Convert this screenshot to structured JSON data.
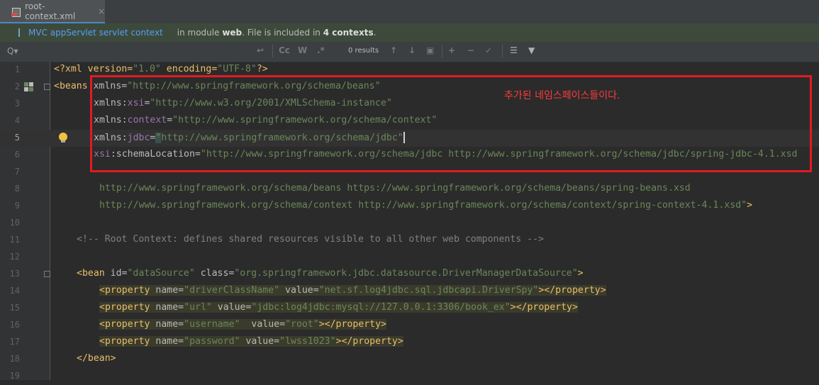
{
  "tab": {
    "filename": "root-context.xml",
    "close": "×"
  },
  "infobar": {
    "link": "MVC appServlet servlet context",
    "text_before": "in module",
    "module": "web",
    "text_middle": ". File is included in",
    "contexts": "4 contexts",
    "text_end": "."
  },
  "search": {
    "icon": "Q▾",
    "results": "0 results",
    "toolbar": {
      "cc": "Cc",
      "w": "W",
      "regex": ".*"
    }
  },
  "code": {
    "l1": {
      "num": "1",
      "t1": "<?xml version=",
      "v1": "\"1.0\"",
      "t2": " encoding=",
      "v2": "\"UTF-8\"",
      "t3": "?>"
    },
    "l2": {
      "num": "2",
      "tag": "<beans ",
      "a1": "xmlns",
      "eq": "=",
      "v": "\"http://www.springframework.org/schema/beans\""
    },
    "l3": {
      "num": "3",
      "a1": "xmlns:",
      "a2": "xsi",
      "eq": "=",
      "v": "\"http://www.w3.org/2001/XMLSchema-instance\""
    },
    "l4": {
      "num": "4",
      "a1": "xmlns:",
      "a2": "context",
      "eq": "=",
      "v": "\"http://www.springframework.org/schema/context\""
    },
    "l5": {
      "num": "5",
      "a1": "xmlns:",
      "a2": "jdbc",
      "eq": "=",
      "q": "\"",
      "v": "http://www.springframework.org/schema/jdbc\""
    },
    "l6": {
      "num": "6",
      "a1": "xsi",
      "a2": ":schemaLocation",
      "eq": "=",
      "v": "\"http://www.springframework.org/schema/jdbc http://www.springframework.org/schema/jdbc/spring-jdbc-4.1.xsd"
    },
    "l7": {
      "num": "7"
    },
    "l8": {
      "num": "8",
      "v": "http://www.springframework.org/schema/beans https://www.springframework.org/schema/beans/spring-beans.xsd"
    },
    "l9": {
      "num": "9",
      "v": "http://www.springframework.org/schema/context http://www.springframework.org/schema/context/spring-context-4.1.xsd\"",
      "end": ">"
    },
    "l10": {
      "num": "10"
    },
    "l11": {
      "num": "11",
      "c": "<!-- Root Context: defines shared resources visible to all other web components -->"
    },
    "l12": {
      "num": "12"
    },
    "l13": {
      "num": "13",
      "tag": "<bean ",
      "a1": "id",
      "eq1": "=",
      "v1": "\"dataSource\"",
      "a2": " class",
      "eq2": "=",
      "v2": "\"org.springframework.jdbc.datasource.DriverManagerDataSource\"",
      "end": ">"
    },
    "l14": {
      "num": "14",
      "open": "<property ",
      "a1": "name",
      "eq1": "=",
      "v1": "\"driverClassName\"",
      "a2": " value",
      "eq2": "=",
      "v2": "\"net.sf.log4jdbc.sql.jdbcapi.DriverSpy\"",
      "close": "></property>"
    },
    "l15": {
      "num": "15",
      "open": "<property ",
      "a1": "name",
      "eq1": "=",
      "v1": "\"url\"",
      "a2": " value",
      "eq2": "=",
      "v2": "\"jdbc:log4jdbc:mysql://127.0.0.1:3306/book_ex\"",
      "close": "></property>"
    },
    "l16": {
      "num": "16",
      "open": "<property ",
      "a1": "name",
      "eq1": "=",
      "v1": "\"username\"",
      "a2": "  value",
      "eq2": "=",
      "v2": "\"root\"",
      "close": "></property>"
    },
    "l17": {
      "num": "17",
      "open": "<property ",
      "a1": "name",
      "eq1": "=",
      "v1": "\"password\"",
      "a2": " value",
      "eq2": "=",
      "v2": "\"lwss1023\"",
      "close": "></property>"
    },
    "l18": {
      "num": "18",
      "tag": "</bean>"
    },
    "l19": {
      "num": "19"
    }
  },
  "annotation": {
    "text": "추가된 네임스페이스들이다.",
    "color": "#e11b22"
  },
  "colors": {
    "tag": "#e8bf6a",
    "attr": "#bababa",
    "namespace": "#9876aa",
    "string": "#6a8759",
    "comment": "#808080",
    "accent": "#4a88c7"
  }
}
